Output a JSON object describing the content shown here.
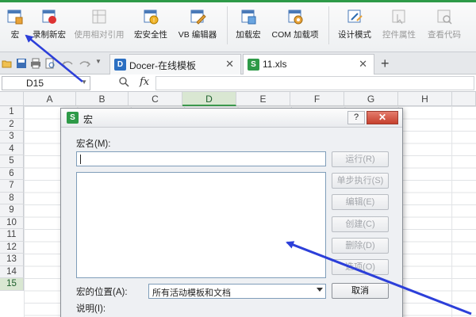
{
  "ribbon": {
    "buttons": [
      {
        "label": "宏",
        "icon": "macro-icon",
        "enabled": true
      },
      {
        "label": "录制新宏",
        "icon": "record-macro-icon",
        "enabled": true
      },
      {
        "label": "使用相对引用",
        "icon": "relative-reference-icon",
        "enabled": false
      },
      {
        "label": "宏安全性",
        "icon": "macro-security-icon",
        "enabled": true
      },
      {
        "label": "VB 编辑器",
        "icon": "vb-editor-icon",
        "enabled": true
      },
      {
        "label": "加载宏",
        "icon": "addin-icon",
        "enabled": true
      },
      {
        "label": "COM 加载项",
        "icon": "com-addin-icon",
        "enabled": true
      },
      {
        "label": "设计模式",
        "icon": "design-mode-icon",
        "enabled": true
      },
      {
        "label": "控件属性",
        "icon": "control-properties-icon",
        "enabled": false
      },
      {
        "label": "查看代码",
        "icon": "view-code-icon",
        "enabled": false
      }
    ]
  },
  "tabs": [
    {
      "label": "Docer-在线模板",
      "icon_text": "D",
      "color": "#2b6fc2"
    },
    {
      "label": "11.xls",
      "icon_text": "S",
      "color": "#2e9a48"
    }
  ],
  "tab_close": "✕",
  "new_tab": "+",
  "formula_bar": {
    "cell_ref": "D15",
    "fx": "fx",
    "value": ""
  },
  "columns": [
    "A",
    "B",
    "C",
    "D",
    "E",
    "F",
    "G",
    "H"
  ],
  "selected_column": "D",
  "rows": [
    "1",
    "2",
    "3",
    "4",
    "5",
    "6",
    "7",
    "8",
    "9",
    "10",
    "11",
    "12",
    "13",
    "14",
    "15"
  ],
  "selected_row": "15",
  "dialog": {
    "title": "宏",
    "help": "?",
    "close": "✕",
    "macro_name_label": "宏名(M):",
    "macro_name_value": "",
    "buttons": [
      {
        "label": "运行(R)",
        "enabled": false
      },
      {
        "label": "单步执行(S)",
        "enabled": false
      },
      {
        "label": "编辑(E)",
        "enabled": false
      },
      {
        "label": "创建(C)",
        "enabled": false
      },
      {
        "label": "删除(D)",
        "enabled": false
      },
      {
        "label": "选项(O)",
        "enabled": false
      }
    ],
    "location_label": "宏的位置(A):",
    "location_value": "所有活动模板和文档",
    "cancel": "取消",
    "description_label": "说明(I):"
  },
  "colors": {
    "accent_green": "#2e9a48",
    "arrow_blue": "#2c3fd9"
  }
}
